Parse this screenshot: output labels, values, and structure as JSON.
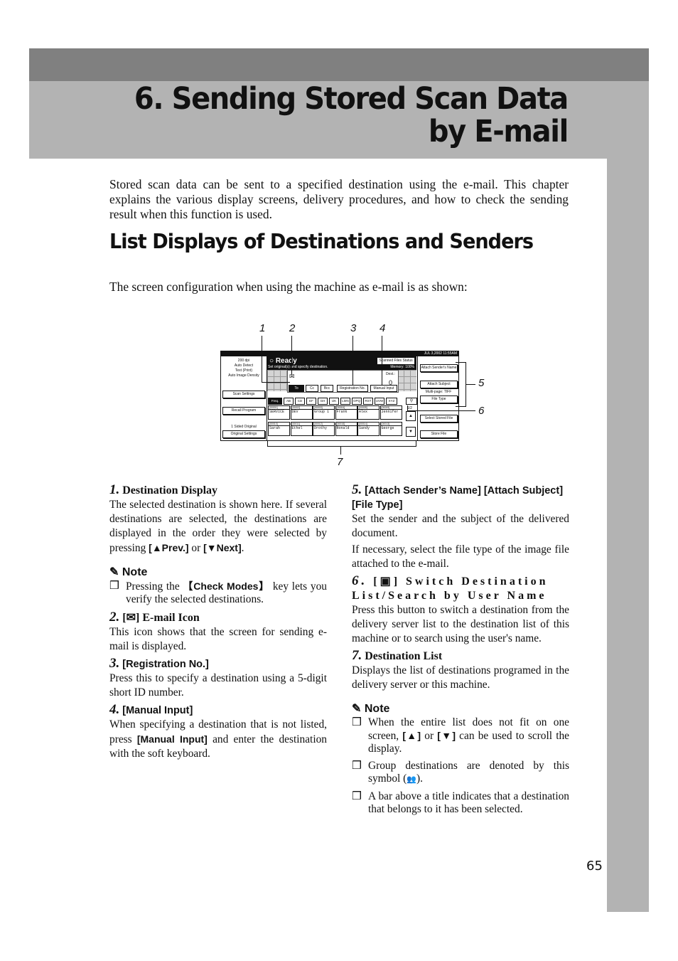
{
  "chapter": {
    "title_line1": "6. Sending Stored Scan Data",
    "title_line2": "by E-mail"
  },
  "intro": "Stored scan data can be sent to a specified destination using the e-mail. This chapter explains the various display screens, delivery procedures, and how to check the sending result when this function is used.",
  "section_heading": "List Displays of Destinations and Senders",
  "screen_intro": "The screen configuration when using the machine as e-mail is as shown:",
  "diagram": {
    "callouts": [
      "1",
      "2",
      "3",
      "4",
      "5",
      "6",
      "7"
    ],
    "date": "JUL   3,2002 11:55AM",
    "left_info": [
      "200 dpi",
      "Auto Detect",
      "Text (Print)",
      "Auto Image Density"
    ],
    "scan_settings": "Scan Settings",
    "recall_program": "Recall Program",
    "sided": "1 Sided Original",
    "original_settings": "Original Settings",
    "ready": "Ready",
    "ready_sub": "Set original(s) and specify destination.",
    "scanned_files_status": "Scanned Files Status",
    "memory": "Memory: 100%",
    "dest_label": "Dest.:",
    "dest_count": "0",
    "tabs": [
      "To",
      "Cc",
      "Bcc",
      "Registration No.",
      "Manual Input"
    ],
    "index_tabs": [
      "Freq.",
      "AB",
      "CD",
      "EF",
      "GH",
      "IJK",
      "LMN",
      "OPQ",
      "RST",
      "UVW",
      "XYZ"
    ],
    "page": "1/2",
    "destinations_row1": [
      {
        "id": "[00001]",
        "name": "SERVICE"
      },
      {
        "id": "[00002]",
        "name": "DEV"
      },
      {
        "id": "[00003]",
        "name": "Group 1"
      },
      {
        "id": "[00004]",
        "name": "Frank"
      },
      {
        "id": "[00005]",
        "name": "Alex"
      },
      {
        "id": "[00009]",
        "name": "Jennifer"
      }
    ],
    "destinations_row2": [
      {
        "id": "[00010]",
        "name": "Sarah"
      },
      {
        "id": "[00011]",
        "name": "Ethel"
      },
      {
        "id": "[00012]",
        "name": "Drothy"
      },
      {
        "id": "[00015]",
        "name": "Ronald"
      },
      {
        "id": "[00014]",
        "name": "Sandy"
      },
      {
        "id": "[00013]",
        "name": "George"
      }
    ],
    "attach_sender": "Attach Sender's Name",
    "attach_subject": "Attach Subject",
    "multi_page": "Multi-page: TIFF",
    "file_type": "File Type",
    "select_stored_file": "Select Stored File",
    "store_file": "Store File",
    "up": "▲",
    "down": "▼"
  },
  "items": {
    "i1": {
      "num": "1.",
      "title": "Destination Display",
      "body_a": "The selected destination is shown here. If several destinations are selected, the destinations are displayed in the order they were selected by pressing ",
      "prev": "[▲Prev.]",
      "or": " or ",
      "next": "[▼Next]",
      "end": "."
    },
    "note1": {
      "heading": "Note",
      "a": "Pressing the ",
      "key": "【Check Modes】",
      "b": " key lets you verify the selected destinations."
    },
    "i2": {
      "num": "2.",
      "title": "E-mail Icon",
      "body": "This icon shows that the screen for sending e-mail is displayed."
    },
    "i3": {
      "num": "3.",
      "title": "[Registration No.]",
      "body": "Press this to specify a destination using a 5-digit short ID number."
    },
    "i4": {
      "num": "4.",
      "title": "[Manual Input]",
      "body_a": "When specifying a destination that is not listed, press ",
      "key": "[Manual Input]",
      "body_b": " and enter the destination with the soft keyboard."
    },
    "i5": {
      "num": "5.",
      "title": "[Attach Sender’s Name] [Attach Subject] [File Type]",
      "body1": "Set the sender and the subject of the delivered document.",
      "body2": "If necessary, select the file type of the image file attached to the e-mail."
    },
    "i6": {
      "num": "6.",
      "title": "Switch Destination List/Search by User Name",
      "body": "Press this button to switch a destination from the delivery server list to the destination list of this machine or to search using the user's name."
    },
    "i7": {
      "num": "7.",
      "title": "Destination List",
      "body": "Displays the list of destinations programed in the delivery server or this machine."
    },
    "note2": {
      "heading": "Note",
      "n1a": "When the entire list does not fit on one screen, ",
      "up": "[▲]",
      "n1b": " or ",
      "down": "[▼]",
      "n1c": " can be used to scroll the display.",
      "n2a": "Group destinations are denoted by this symbol (",
      "n2b": ").",
      "n3": "A bar above a title indicates that a destination that belongs to it has been selected."
    }
  },
  "page_number": "65"
}
